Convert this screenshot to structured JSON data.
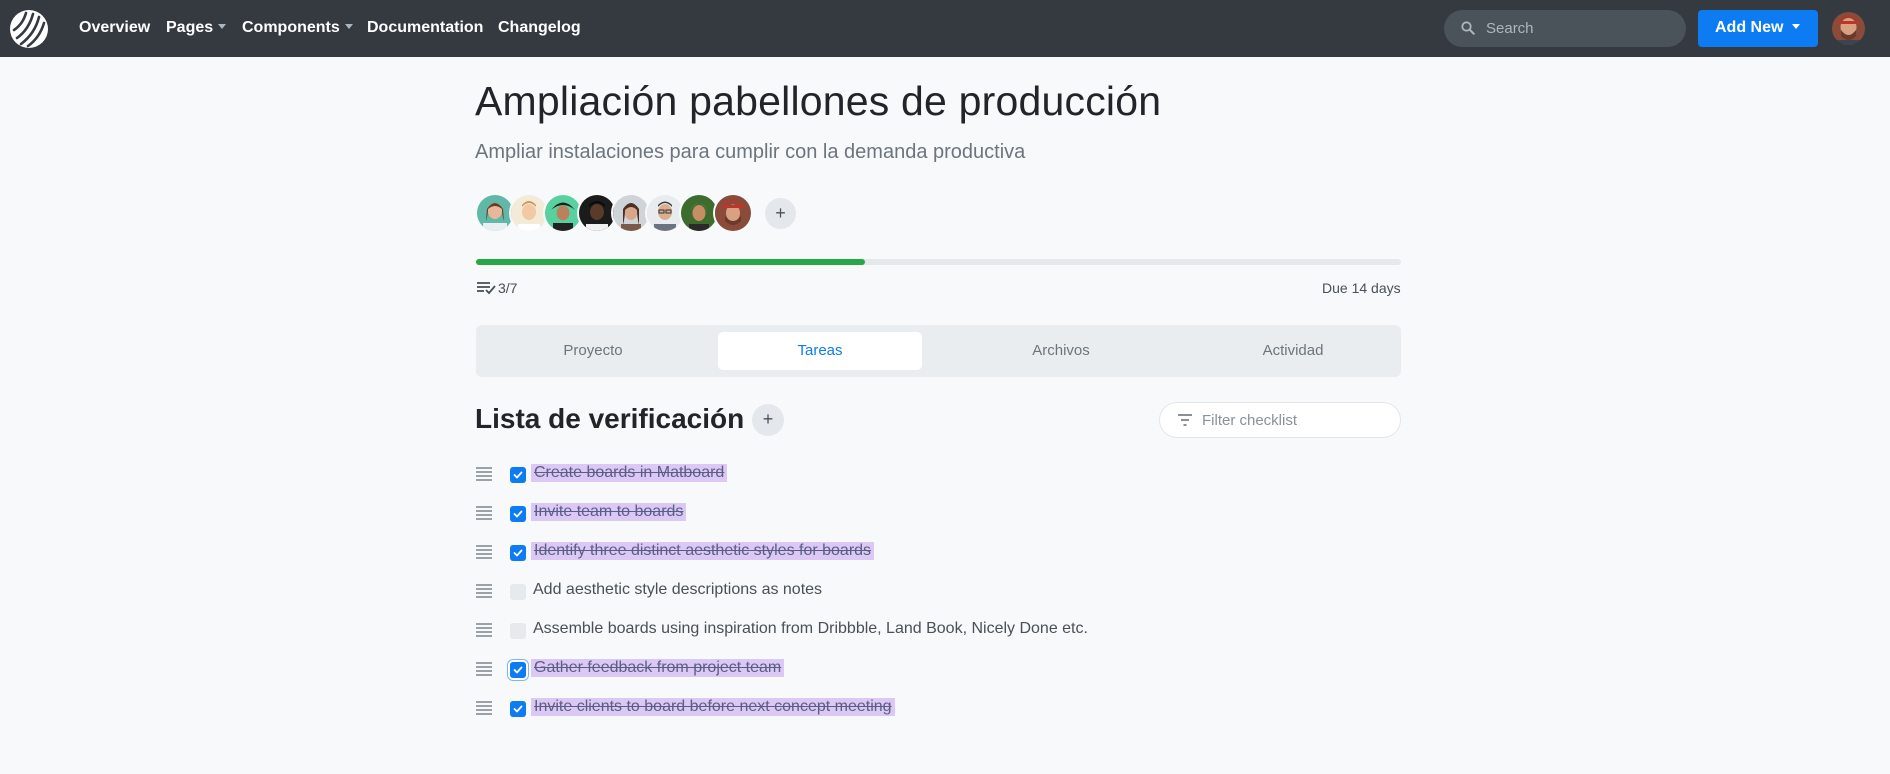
{
  "navbar": {
    "logo": "striped-circle-logo",
    "items": [
      {
        "label": "Overview",
        "has_caret": false
      },
      {
        "label": "Pages",
        "has_caret": true
      },
      {
        "label": "Components",
        "has_caret": true
      },
      {
        "label": "Documentation",
        "has_caret": false
      },
      {
        "label": "Changelog",
        "has_caret": false
      }
    ],
    "search_placeholder": "Search",
    "add_new_label": "Add New",
    "accent_color": "#0d7cf2"
  },
  "project": {
    "title": "Ampliación pabellones de producción",
    "subtitle": "Ampliar instalaciones para cumplir con la demanda productiva",
    "add_member_label": "+",
    "progress_fraction": 0.42,
    "progress_color": "#28a745",
    "tasks_done_label": "3/7",
    "due_label": "Due 14 days"
  },
  "tabs": [
    {
      "label": "Proyecto",
      "active": false
    },
    {
      "label": "Tareas",
      "active": true
    },
    {
      "label": "Archivos",
      "active": false
    },
    {
      "label": "Actividad",
      "active": false
    }
  ],
  "checklist": {
    "title": "Lista de verificación",
    "add_label": "+",
    "filter_placeholder": "Filter checklist",
    "items": [
      {
        "label": "Create boards in Matboard",
        "checked": true
      },
      {
        "label": "Invite team to boards",
        "checked": true
      },
      {
        "label": "Identify three distinct aesthetic styles for boards",
        "checked": true
      },
      {
        "label": "Add aesthetic style descriptions as notes",
        "checked": false
      },
      {
        "label": "Assemble boards using inspiration from Dribbble, Land Book, Nicely Done etc.",
        "checked": false
      },
      {
        "label": "Gather feedback from project team",
        "checked": true
      },
      {
        "label": "Invite clients to board before next concept meeting",
        "checked": true
      }
    ]
  }
}
